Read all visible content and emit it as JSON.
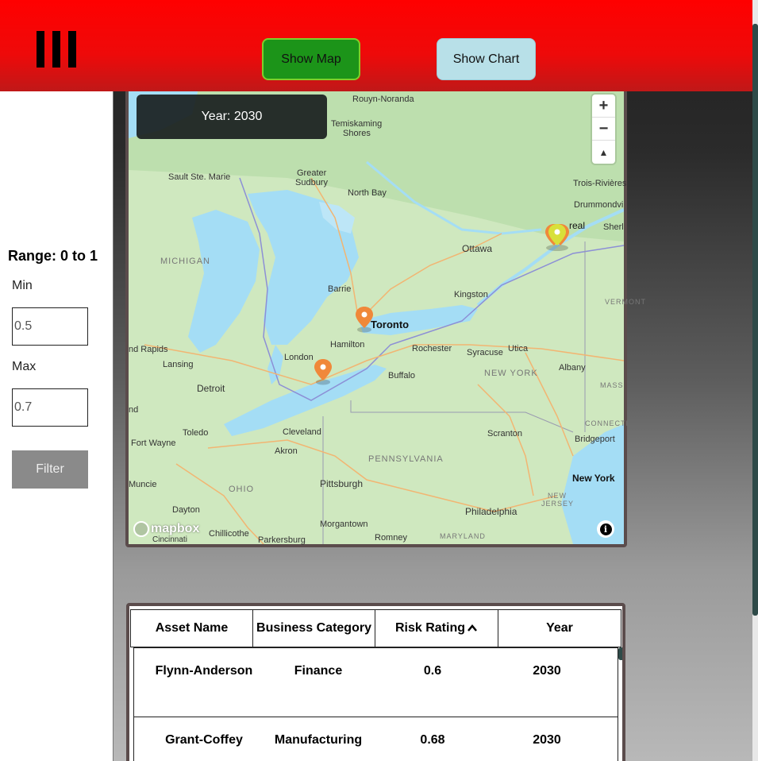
{
  "header": {
    "menu_icon": "hamburger-menu-icon",
    "show_map_label": "Show Map",
    "show_chart_label": "Show Chart",
    "colors": {
      "header_bg": "#ff0000",
      "map_button": "#1c9419",
      "chart_button": "#b8e0e8"
    }
  },
  "sidebar": {
    "range_title": "Range: 0 to 1",
    "min_label": "Min",
    "min_value": "0.5",
    "max_label": "Max",
    "max_value": "0.7",
    "filter_label": "Filter"
  },
  "map": {
    "year_label": "Year: 2030",
    "zoom_in": "+",
    "zoom_out": "−",
    "compass": "▲",
    "attribution_logo": "mapbox",
    "info": "i",
    "labels": {
      "rouyn": "Rouyn-Noranda",
      "temiskaming": "Temiskaming",
      "shores": "Shores",
      "sault": "Sault Ste. Marie",
      "greater": "Greater",
      "sudbury": "Sudbury",
      "northbay": "North Bay",
      "trois": "Trois-Rivières",
      "drummond": "Drummondvi",
      "sher": "Sherl",
      "montreal": "real",
      "ottawa": "Ottawa",
      "michigan": "MICHIGAN",
      "barrie": "Barrie",
      "kingston": "Kingston",
      "vermont": "VERMONT",
      "toronto": "Toronto",
      "rapids": "nd Rapids",
      "hamilton": "Hamilton",
      "rochester": "Rochester",
      "syracuse": "Syracuse",
      "utica": "Utica",
      "lansing": "Lansing",
      "london": "London",
      "buffalo": "Buffalo",
      "newyorkstate": "NEW YORK",
      "albany": "Albany",
      "mass": "MASS",
      "detroit": "Detroit",
      "nd": "nd",
      "connecti": "CONNECTI",
      "toledo": "Toledo",
      "cleveland": "Cleveland",
      "fortwayne": "Fort Wayne",
      "akron": "Akron",
      "scranton": "Scranton",
      "bridgeport": "Bridgeport",
      "pennsylvania": "PENNSYLVANIA",
      "newyorkcity": "New York",
      "muncie": "Muncie",
      "ohio": "OHIO",
      "pittsburgh": "Pittsburgh",
      "newjersey1": "NEW",
      "newjersey2": "JERSEY",
      "dayton": "Dayton",
      "philadelphia": "Philadelphia",
      "chillicothe": "Chillicothe",
      "cincinnati": "Cincinnati",
      "morgantown": "Morgantown",
      "parkersburg": "Parkersburg",
      "romney": "Romney",
      "maryland": "MARYLAND"
    },
    "pin_colors": {
      "orange": "#f0883a",
      "yellow": "#d8e03a"
    }
  },
  "table": {
    "headers": [
      "Asset Name",
      "Business Category",
      "Risk Rating",
      "Year"
    ],
    "sort_icon": "chevron-up-icon",
    "rows": [
      {
        "asset": "Flynn-Anderson",
        "category": "Finance",
        "risk": "0.6",
        "year": "2030"
      },
      {
        "asset": "Grant-Coffey",
        "category": "Manufacturing",
        "risk": "0.68",
        "year": "2030"
      }
    ]
  }
}
